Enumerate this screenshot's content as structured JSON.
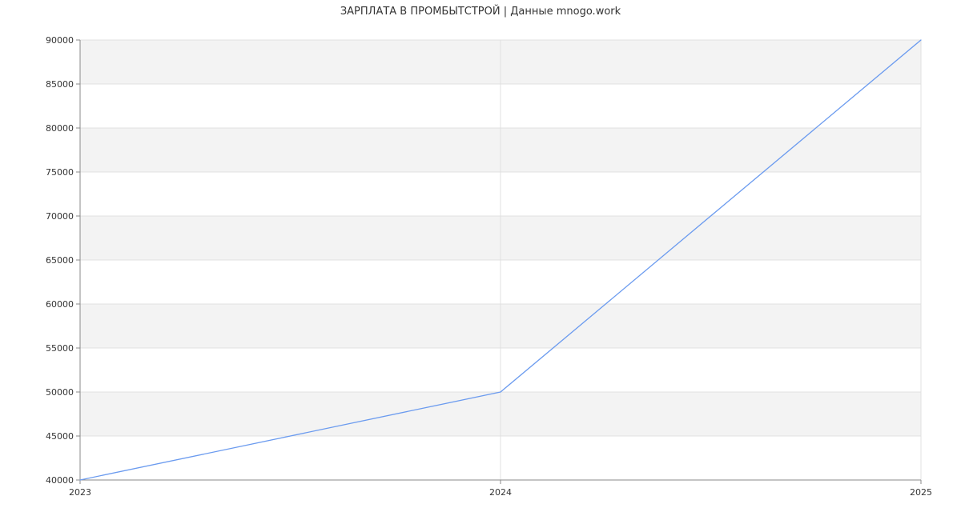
{
  "chart_data": {
    "type": "line",
    "title": "ЗАРПЛАТА В ПРОМБЫТСТРОЙ | Данные mnogo.work",
    "xlabel": "",
    "ylabel": "",
    "x": [
      "2023",
      "2024",
      "2025"
    ],
    "series": [
      {
        "values": [
          40000,
          50000,
          90000
        ],
        "color": "#6b9bef"
      }
    ],
    "ylim": [
      40000,
      90000
    ],
    "yticks": [
      40000,
      45000,
      50000,
      55000,
      60000,
      65000,
      70000,
      75000,
      80000,
      85000,
      90000
    ],
    "ytick_labels": [
      "40000",
      "45000",
      "50000",
      "55000",
      "60000",
      "65000",
      "70000",
      "75000",
      "80000",
      "85000",
      "90000"
    ],
    "xtick_labels": [
      "2023",
      "2024",
      "2025"
    ],
    "grid": true,
    "band_colors": [
      "#f3f3f3",
      "#ffffff"
    ],
    "grid_color": "#e0e0e0",
    "axis_color": "#888888"
  }
}
